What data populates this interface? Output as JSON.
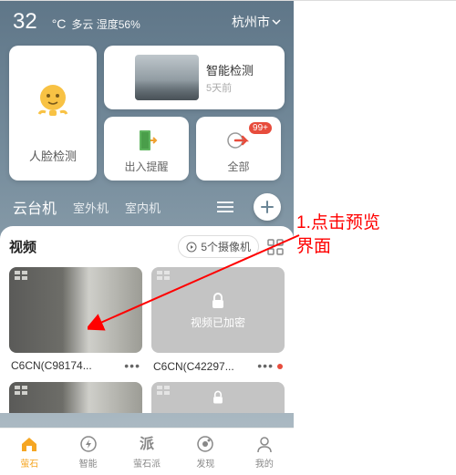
{
  "weather": {
    "temp": "32",
    "unit": "°C",
    "condition": "多云 湿度56%",
    "city": "杭州市"
  },
  "features": {
    "face_detect": "人脸检测",
    "smart_detect_title": "智能检测",
    "smart_detect_sub": "5天前",
    "in_out": "出入提醒",
    "all": "全部",
    "badge": "99+"
  },
  "tabs": {
    "active": "云台机",
    "t2": "室外机",
    "t3": "室内机"
  },
  "video": {
    "title": "视频",
    "count_label": "5个摄像机",
    "encrypted": "视频已加密",
    "cam1": "C6CN(C98174...",
    "cam2": "C6CN(C42297..."
  },
  "nav": {
    "n1": "萤石",
    "n2": "智能",
    "n3": "萤石派",
    "n4": "发现",
    "n5": "我的"
  },
  "annotation": {
    "line1": "1.点击预览",
    "line2": "界面"
  }
}
